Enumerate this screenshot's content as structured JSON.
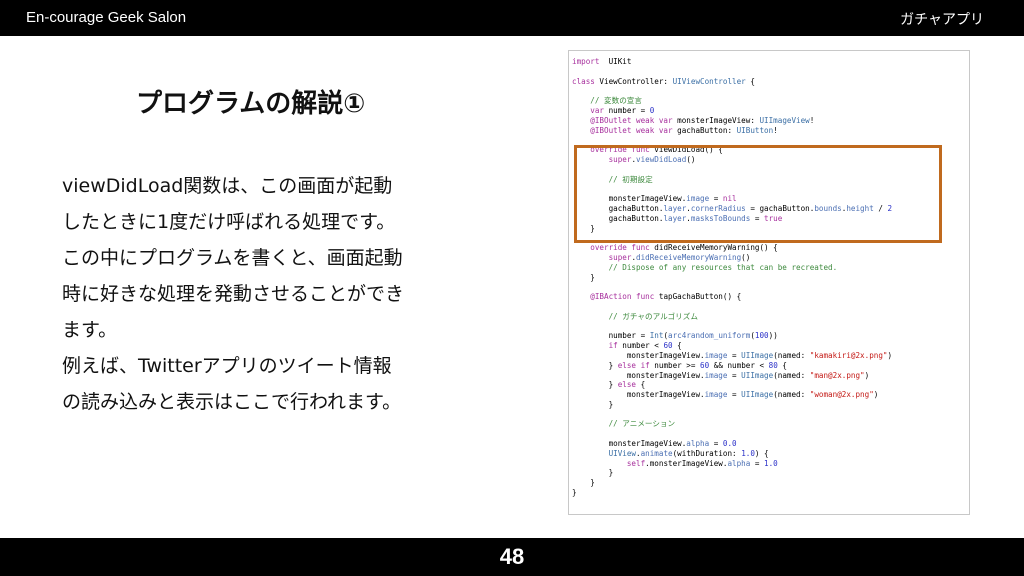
{
  "header": {
    "left": "En-courage Geek Salon",
    "right": "ガチャアプリ"
  },
  "slide": {
    "title": "プログラムの解説①",
    "body_lines": [
      "viewDidLoad関数は、この画面が起動",
      "したときに1度だけ呼ばれる処理です。",
      "この中にプログラムを書くと、画面起動",
      "時に好きな処理を発動させることができ",
      "ます。",
      "例えば、Twitterアプリのツイート情報",
      "の読み込みと表示はここで行われます。"
    ]
  },
  "code": {
    "lines": [
      [
        [
          "k",
          "import"
        ],
        [
          "",
          "  UIKit"
        ]
      ],
      [],
      [
        [
          "k",
          "class"
        ],
        [
          "",
          " ViewController: "
        ],
        [
          "t",
          "UIViewController"
        ],
        [
          "",
          " {"
        ]
      ],
      [],
      [
        [
          "c",
          "    // 変数の宣言"
        ]
      ],
      [
        [
          "k",
          "    var"
        ],
        [
          "",
          " number = "
        ],
        [
          "n",
          "0"
        ]
      ],
      [
        [
          "k",
          "    @IBOutlet weak var"
        ],
        [
          "",
          " monsterImageView: "
        ],
        [
          "t",
          "UIImageView"
        ],
        [
          "",
          "!"
        ]
      ],
      [
        [
          "k",
          "    @IBOutlet weak var"
        ],
        [
          "",
          " gachaButton: "
        ],
        [
          "t",
          "UIButton"
        ],
        [
          "",
          "!"
        ]
      ],
      [],
      [
        [
          "k",
          "    override func"
        ],
        [
          "",
          " viewDidLoad() {"
        ]
      ],
      [
        [
          "k",
          "        super"
        ],
        [
          "",
          "."
        ],
        [
          "p",
          "viewDidLoad"
        ],
        [
          "",
          "()"
        ]
      ],
      [],
      [
        [
          "c",
          "        // 初期設定"
        ]
      ],
      [],
      [
        [
          "",
          "        monsterImageView."
        ],
        [
          "p",
          "image"
        ],
        [
          "",
          " = "
        ],
        [
          "k",
          "nil"
        ]
      ],
      [
        [
          "",
          "        gachaButton."
        ],
        [
          "p",
          "layer"
        ],
        [
          "",
          "."
        ],
        [
          "p",
          "cornerRadius"
        ],
        [
          "",
          " = gachaButton."
        ],
        [
          "p",
          "bounds"
        ],
        [
          "",
          "."
        ],
        [
          "p",
          "height"
        ],
        [
          "",
          " / "
        ],
        [
          "n",
          "2"
        ]
      ],
      [
        [
          "",
          "        gachaButton."
        ],
        [
          "p",
          "layer"
        ],
        [
          "",
          "."
        ],
        [
          "p",
          "masksToBounds"
        ],
        [
          "",
          " = "
        ],
        [
          "k",
          "true"
        ]
      ],
      [
        [
          "",
          "    }"
        ]
      ],
      [],
      [
        [
          "k",
          "    override func"
        ],
        [
          "",
          " didReceiveMemoryWarning() {"
        ]
      ],
      [
        [
          "k",
          "        super"
        ],
        [
          "",
          "."
        ],
        [
          "p",
          "didReceiveMemoryWarning"
        ],
        [
          "",
          "()"
        ]
      ],
      [
        [
          "c",
          "        // Dispose of any resources that can be recreated."
        ]
      ],
      [
        [
          "",
          "    }"
        ]
      ],
      [],
      [
        [
          "k",
          "    @IBAction func"
        ],
        [
          "",
          " tapGachaButton() {"
        ]
      ],
      [],
      [
        [
          "c",
          "        // ガチャのアルゴリズム"
        ]
      ],
      [],
      [
        [
          "",
          "        number = "
        ],
        [
          "t",
          "Int"
        ],
        [
          "",
          "("
        ],
        [
          "p",
          "arc4random_uniform"
        ],
        [
          "",
          "("
        ],
        [
          "n",
          "100"
        ],
        [
          "",
          "))"
        ]
      ],
      [
        [
          "k",
          "        if"
        ],
        [
          "",
          " number < "
        ],
        [
          "n",
          "60"
        ],
        [
          "",
          " {"
        ]
      ],
      [
        [
          "",
          "            monsterImageView."
        ],
        [
          "p",
          "image"
        ],
        [
          "",
          " = "
        ],
        [
          "t",
          "UIImage"
        ],
        [
          "",
          "(named: "
        ],
        [
          "s",
          "\"kamakiri@2x.png\""
        ],
        [
          "",
          ")"
        ]
      ],
      [
        [
          "",
          "        } "
        ],
        [
          "k",
          "else if"
        ],
        [
          "",
          " number >= "
        ],
        [
          "n",
          "60"
        ],
        [
          "",
          " && number < "
        ],
        [
          "n",
          "80"
        ],
        [
          "",
          " {"
        ]
      ],
      [
        [
          "",
          "            monsterImageView."
        ],
        [
          "p",
          "image"
        ],
        [
          "",
          " = "
        ],
        [
          "t",
          "UIImage"
        ],
        [
          "",
          "(named: "
        ],
        [
          "s",
          "\"man@2x.png\""
        ],
        [
          "",
          ")"
        ]
      ],
      [
        [
          "",
          "        } "
        ],
        [
          "k",
          "else"
        ],
        [
          "",
          " {"
        ]
      ],
      [
        [
          "",
          "            monsterImageView."
        ],
        [
          "p",
          "image"
        ],
        [
          "",
          " = "
        ],
        [
          "t",
          "UIImage"
        ],
        [
          "",
          "(named: "
        ],
        [
          "s",
          "\"woman@2x.png\""
        ],
        [
          "",
          ")"
        ]
      ],
      [
        [
          "",
          "        }"
        ]
      ],
      [],
      [
        [
          "c",
          "        // アニメーション"
        ]
      ],
      [],
      [
        [
          "",
          "        monsterImageView."
        ],
        [
          "p",
          "alpha"
        ],
        [
          "",
          " = "
        ],
        [
          "n",
          "0.0"
        ]
      ],
      [
        [
          "",
          "        "
        ],
        [
          "t",
          "UIView"
        ],
        [
          "",
          "."
        ],
        [
          "p",
          "animate"
        ],
        [
          "",
          "(withDuration: "
        ],
        [
          "n",
          "1.0"
        ],
        [
          "",
          ") {"
        ]
      ],
      [
        [
          "k",
          "            self"
        ],
        [
          "",
          ".monsterImageView."
        ],
        [
          "p",
          "alpha"
        ],
        [
          "",
          " = "
        ],
        [
          "n",
          "1.0"
        ]
      ],
      [
        [
          "",
          "        }"
        ]
      ],
      [
        [
          "",
          "    }"
        ]
      ],
      [
        [
          "",
          "}"
        ]
      ]
    ]
  },
  "footer": {
    "page_number": "48"
  }
}
